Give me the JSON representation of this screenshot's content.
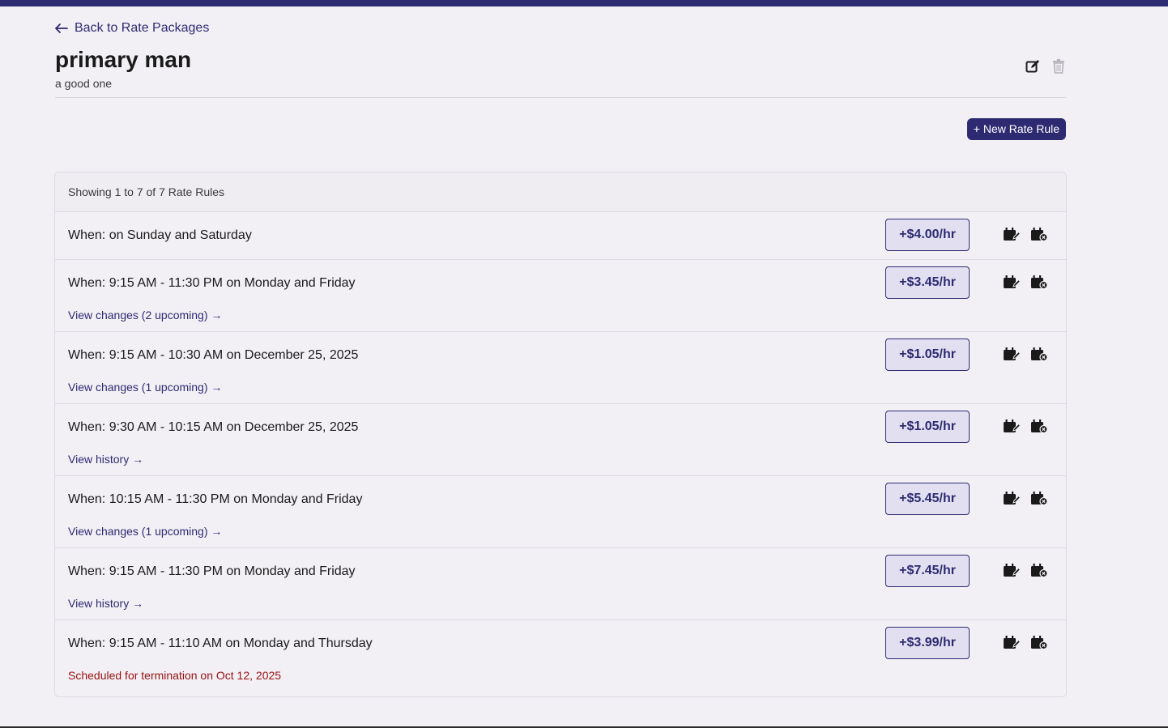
{
  "nav": {
    "back_label": "Back to Rate Packages"
  },
  "package": {
    "title": "primary man",
    "description": "a good one"
  },
  "actions": {
    "new_rule_label": "+ New Rate Rule"
  },
  "rules_list": {
    "summary": "Showing 1 to 7 of 7 Rate Rules",
    "rules": [
      {
        "when": "When: on Sunday and Saturday",
        "rate": "+$4.00/hr",
        "link": "",
        "termination": ""
      },
      {
        "when": "When: 9:15 AM - 11:30 PM on Monday and Friday",
        "rate": "+$3.45/hr",
        "link": "View changes (2 upcoming) →",
        "termination": ""
      },
      {
        "when": "When: 9:15 AM - 10:30 AM on December 25, 2025",
        "rate": "+$1.05/hr",
        "link": "View changes (1 upcoming) →",
        "termination": ""
      },
      {
        "when": "When: 9:30 AM - 10:15 AM on December 25, 2025",
        "rate": "+$1.05/hr",
        "link": "View history →",
        "termination": ""
      },
      {
        "when": "When: 10:15 AM - 11:30 PM on Monday and Friday",
        "rate": "+$5.45/hr",
        "link": "View changes (1 upcoming) →",
        "termination": ""
      },
      {
        "when": "When: 9:15 AM - 11:30 PM on Monday and Friday",
        "rate": "+$7.45/hr",
        "link": "View history →",
        "termination": ""
      },
      {
        "when": "When: 9:15 AM - 11:10 AM on Monday and Thursday",
        "rate": "+$3.99/hr",
        "link": "",
        "termination": "Scheduled for termination on Oct 12, 2025"
      }
    ]
  },
  "icons": {
    "back": "arrow-left-icon",
    "edit": "edit-icon",
    "delete": "trash-icon",
    "rule_edit": "calendar-edit-icon",
    "rule_end": "calendar-close-icon"
  },
  "colors": {
    "brand": "#2e2a72",
    "termination": "#9a1010",
    "badge_bg": "#e2e0f0"
  }
}
